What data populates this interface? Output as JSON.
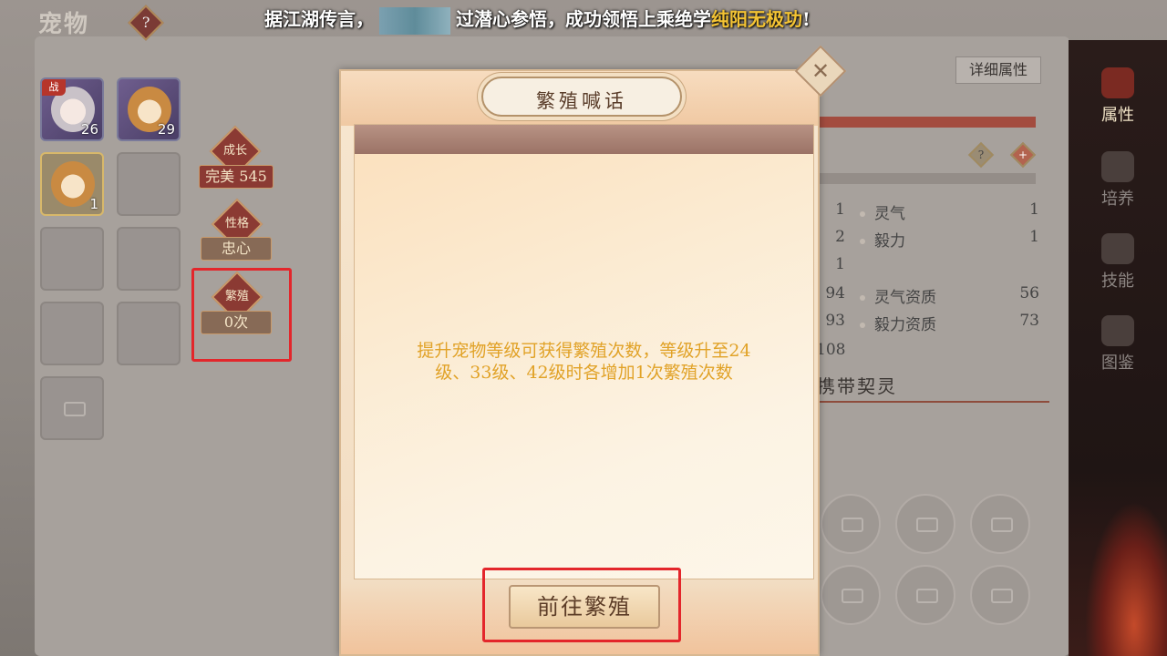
{
  "header": {
    "title": "宠物",
    "help_glyph": "?",
    "marquee_prefix": "据江湖传言，",
    "marquee_middle": "过潜心参悟，成功领悟上乘绝学",
    "marquee_highlight": "纯阳无极功",
    "marquee_suffix": "!"
  },
  "pets": [
    {
      "level": "26",
      "badge": "战",
      "kind": "white"
    },
    {
      "level": "29",
      "badge": "",
      "kind": "orange"
    },
    {
      "level": "1",
      "badge": "",
      "kind": "orange"
    }
  ],
  "stats": {
    "growth_label": "成长",
    "growth_value": "完美 545",
    "personality_label": "性格",
    "personality_value": "忠心",
    "breed_label": "繁殖",
    "breed_value": "0次"
  },
  "right_panel": {
    "detail_button": "详细属性",
    "help_glyph": "?",
    "plus_glyph": "+",
    "rows": [
      {
        "left": "1",
        "label": "灵气",
        "value": "1"
      },
      {
        "left": "2",
        "label": "毅力",
        "value": "1"
      },
      {
        "left": "1",
        "label": "",
        "value": ""
      },
      {
        "left": "94",
        "label": "灵气资质",
        "value": "56"
      },
      {
        "left": "93",
        "label": "毅力资质",
        "value": "73"
      },
      {
        "left": "108",
        "label": "",
        "value": ""
      }
    ],
    "carry_title": "携带契灵"
  },
  "side_nav": [
    {
      "label": "属性",
      "icon": "paw-icon"
    },
    {
      "label": "培养",
      "icon": "cultivate-icon"
    },
    {
      "label": "技能",
      "icon": "scroll-icon"
    },
    {
      "label": "图鉴",
      "icon": "book-icon"
    }
  ],
  "modal": {
    "title": "繁殖喊话",
    "close_glyph": "✕",
    "message": "提升宠物等级可获得繁殖次数，等级升至24级、33级、42级时各增加1次繁殖次数",
    "action_button": "前往繁殖"
  },
  "colors": {
    "highlight_box": "#e3262b",
    "message_text": "#e1a227",
    "marquee_highlight": "#f3c334"
  }
}
